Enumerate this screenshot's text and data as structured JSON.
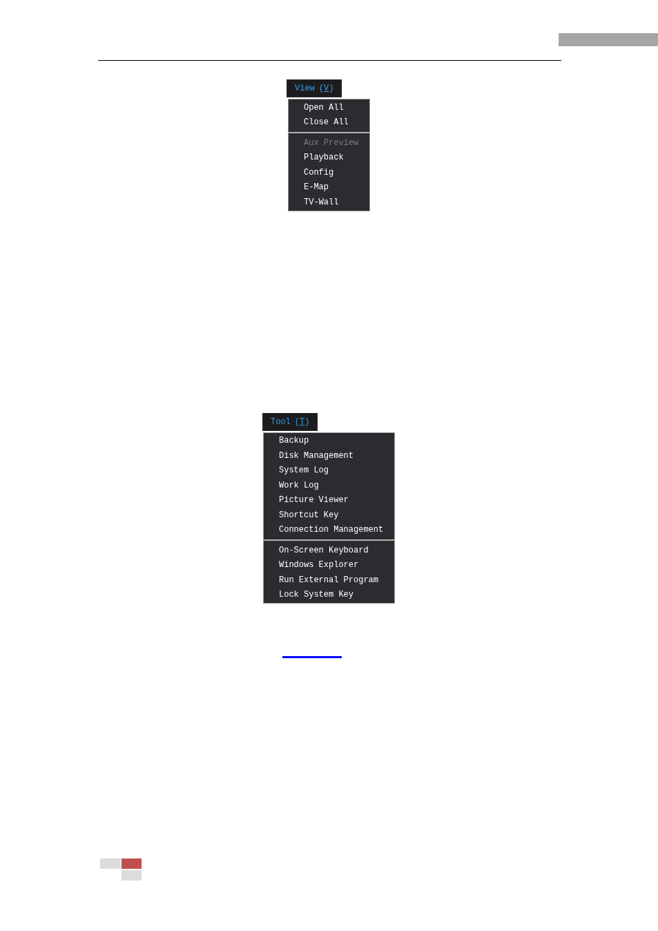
{
  "menus": [
    {
      "title": {
        "label": "View",
        "mnemonic_open": "(",
        "mnemonic": "V",
        "mnemonic_close": ")"
      },
      "sections": [
        {
          "items": [
            {
              "label": "Open All",
              "disabled": false
            },
            {
              "label": "Close All",
              "disabled": false
            }
          ]
        },
        {
          "items": [
            {
              "label": "Aux Preview",
              "disabled": true
            },
            {
              "label": "Playback",
              "disabled": false
            },
            {
              "label": "Config",
              "disabled": false
            },
            {
              "label": "E-Map",
              "disabled": false
            },
            {
              "label": "TV-Wall",
              "disabled": false
            }
          ]
        }
      ]
    },
    {
      "title": {
        "label": "Tool",
        "mnemonic_open": "(",
        "mnemonic": "T",
        "mnemonic_close": ")"
      },
      "sections": [
        {
          "items": [
            {
              "label": "Backup",
              "disabled": false
            },
            {
              "label": "Disk Management",
              "disabled": false
            },
            {
              "label": "System Log",
              "disabled": false
            },
            {
              "label": "Work Log",
              "disabled": false
            },
            {
              "label": "Picture Viewer",
              "disabled": false
            },
            {
              "label": "Shortcut Key",
              "disabled": false
            },
            {
              "label": "Connection Management",
              "disabled": false
            }
          ]
        },
        {
          "items": [
            {
              "label": "On-Screen Keyboard",
              "disabled": false
            },
            {
              "label": "Windows Explorer",
              "disabled": false
            },
            {
              "label": "Run External Program",
              "disabled": false
            },
            {
              "label": "Lock System Key",
              "disabled": false
            }
          ]
        }
      ]
    }
  ]
}
